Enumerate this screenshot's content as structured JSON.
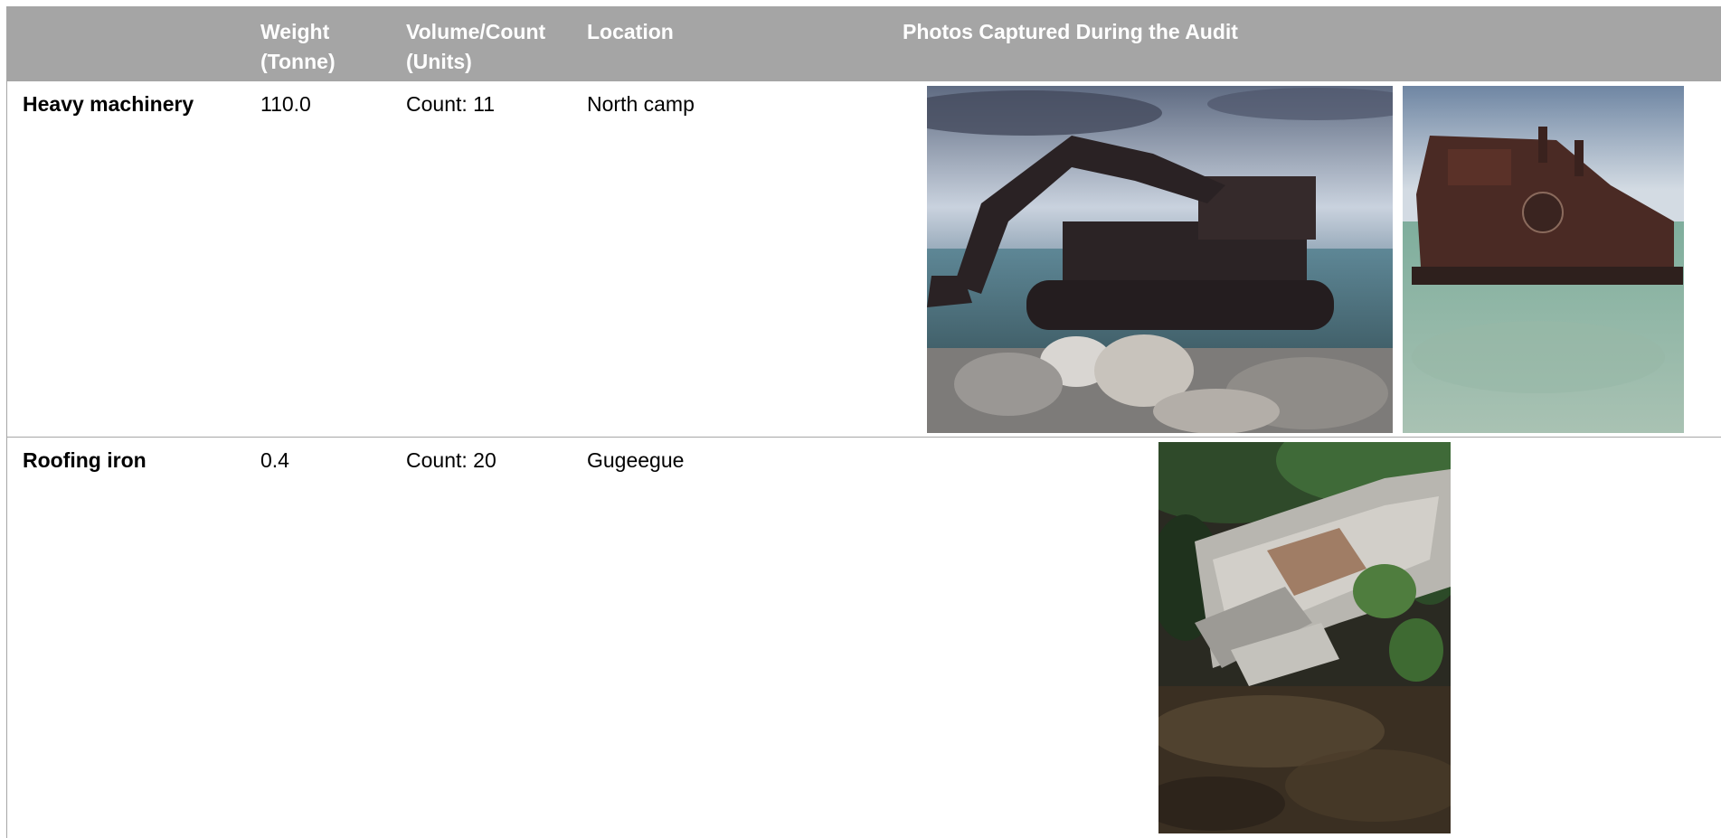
{
  "table": {
    "headers": {
      "item": "",
      "weight": "Weight (Tonne)",
      "volume": "Volume/Count (Units)",
      "location": "Location",
      "photos": "Photos Captured During the Audit"
    },
    "rows": [
      {
        "name": "Heavy machinery",
        "weight": "110.0",
        "volume": "Count: 11",
        "location": "North camp",
        "photos": [
          "excavator on rocky shore photo",
          "rusted machinery in shallow water photo"
        ]
      },
      {
        "name": "Roofing iron",
        "weight": "0.4",
        "volume": "Count: 20",
        "location": "Gugeegue",
        "photos": [
          "collapsed corrugated roofing iron photo"
        ]
      }
    ]
  },
  "colors": {
    "header_bg": "#a5a5a5",
    "header_text": "#ffffff",
    "border": "#a6a6a6"
  }
}
